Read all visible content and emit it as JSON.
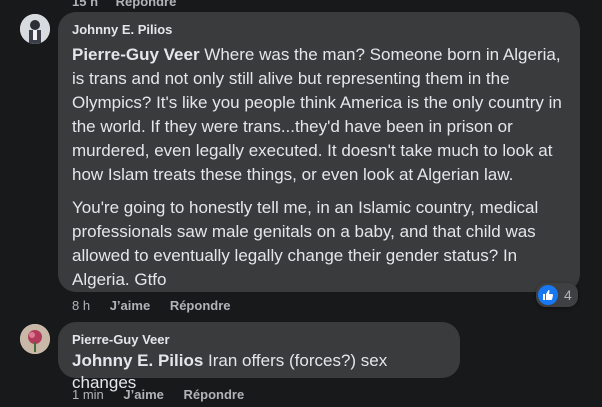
{
  "top": {
    "time": "15 h",
    "reply": "Répondre"
  },
  "comments": [
    {
      "author": "Johnny E. Pilios",
      "mention": "Pierre-Guy Veer",
      "paragraph1": " Where was the man? Someone born in Algeria, is trans and not only still alive but representing them in the Olympics? It's like you people think America is the only country in the world. If they were trans...they'd have been in prison or murdered, even legally executed. It doesn't take much to look at how Islam treats these things, or even look at Algerian law.",
      "paragraph2": "You're going to honestly tell me, in an Islamic country, medical professionals saw male genitals on a baby, and that child was allowed to eventually legally change their gender status? In Algeria. Gtfo",
      "time": "8 h",
      "like": "J’aime",
      "reply": "Répondre",
      "reaction_count": "4",
      "reaction_icon": "like-icon"
    },
    {
      "author": "Pierre-Guy Veer",
      "mention": "Johnny E. Pilios",
      "paragraph1": " Iran offers (forces?) sex changes",
      "time": "1 min",
      "like": "J’aime",
      "reply": "Répondre"
    }
  ],
  "colors": {
    "background": "#18191a",
    "bubble": "#3a3b3c",
    "text": "#e4e6eb",
    "secondary": "#b0b3b8",
    "like_blue": "#1877f2"
  }
}
